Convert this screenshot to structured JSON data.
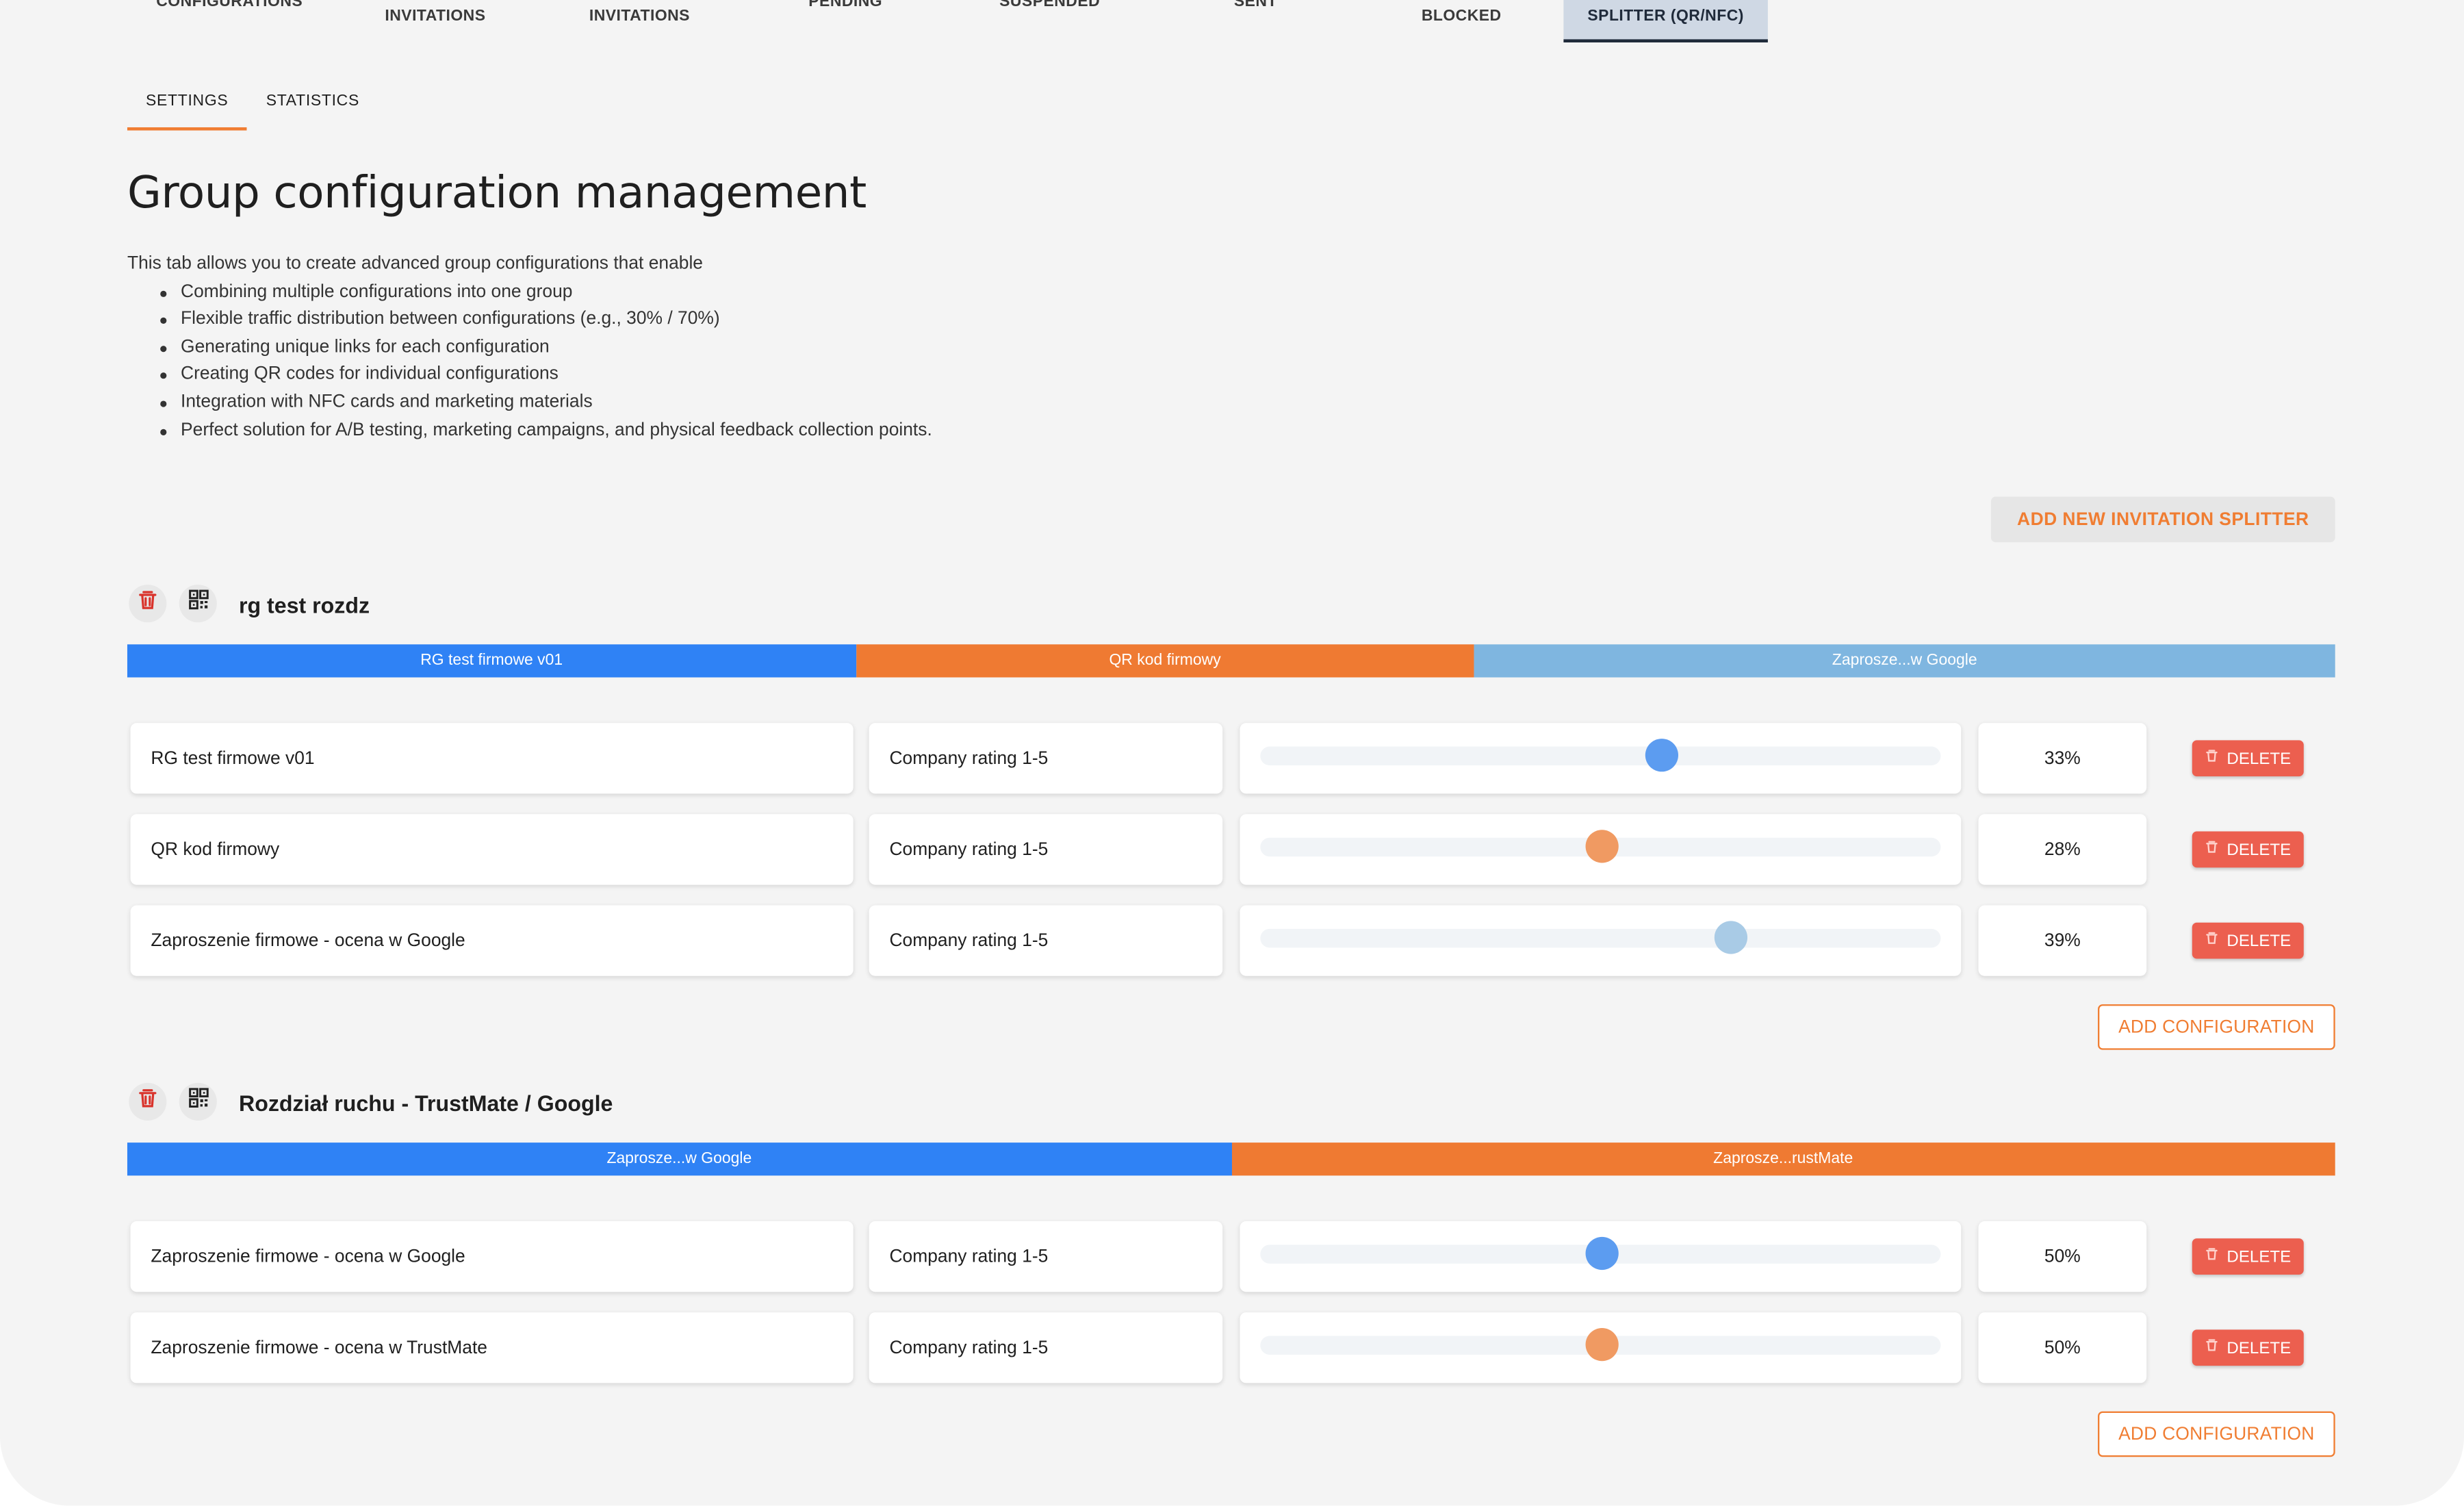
{
  "top_tabs": [
    "CONFIGURATIONS",
    "INVITATIONS",
    "INVITATIONS",
    "PENDING",
    "SUSPENDED",
    "SENT",
    "BLOCKED",
    "SPLITTER (QR/NFC)"
  ],
  "sub_tabs": [
    "SETTINGS",
    "STATISTICS"
  ],
  "title": "Group configuration management",
  "intro": "This tab allows you to create advanced group configurations that enable",
  "bullets": [
    "Combining multiple configurations into one group",
    "Flexible traffic distribution between configurations (e.g., 30% / 70%)",
    "Generating unique links for each configuration",
    "Creating QR codes for individual configurations",
    "Integration with NFC cards and marketing materials",
    "Perfect solution for A/B testing, marketing campaigns, and physical feedback collection points."
  ],
  "add_splitter_label": "ADD NEW INVITATION SPLITTER",
  "colors": {
    "accent": "#f07d32",
    "blue": "#2f82f5",
    "orange": "#ef7a32",
    "light_blue": "#7fb6e0",
    "delete": "#ec5f4f"
  },
  "groups": [
    {
      "name": "rg test rozdz",
      "segments": [
        {
          "label": "RG test firmowe v01",
          "share": 33,
          "color": "#2f82f5"
        },
        {
          "label": "QR kod firmowy",
          "share": 28,
          "color": "#ef7a32"
        },
        {
          "label": "Zaprosze...w Google",
          "share": 39,
          "color": "#7fb6e0"
        }
      ],
      "rows": [
        {
          "name": "RG test firmowe v01",
          "type": "Company rating 1-5",
          "level": 0.59,
          "thumb_color": "#5c9cf0",
          "percent": "33%",
          "delete_label": "DELETE"
        },
        {
          "name": "QR kod firmowy",
          "type": "Company rating 1-5",
          "level": 0.5,
          "thumb_color": "#f09a62",
          "percent": "28%",
          "delete_label": "DELETE"
        },
        {
          "name": "Zaproszenie firmowe - ocena w Google",
          "type": "Company rating 1-5",
          "level": 0.69,
          "thumb_color": "#a9cbe6",
          "percent": "39%",
          "delete_label": "DELETE"
        }
      ],
      "add_label": "ADD CONFIGURATION"
    },
    {
      "name": "Rozdział ruchu - TrustMate / Google",
      "segments": [
        {
          "label": "Zaprosze...w Google",
          "share": 50,
          "color": "#2f82f5"
        },
        {
          "label": "Zaprosze...rustMate",
          "share": 50,
          "color": "#ef7a32"
        }
      ],
      "rows": [
        {
          "name": "Zaproszenie firmowe - ocena w Google",
          "type": "Company rating 1-5",
          "level": 0.5,
          "thumb_color": "#5c9cf0",
          "percent": "50%",
          "delete_label": "DELETE"
        },
        {
          "name": "Zaproszenie firmowe - ocena w TrustMate",
          "type": "Company rating 1-5",
          "level": 0.5,
          "thumb_color": "#f09a62",
          "percent": "50%",
          "delete_label": "DELETE"
        }
      ],
      "add_label": "ADD CONFIGURATION"
    }
  ]
}
